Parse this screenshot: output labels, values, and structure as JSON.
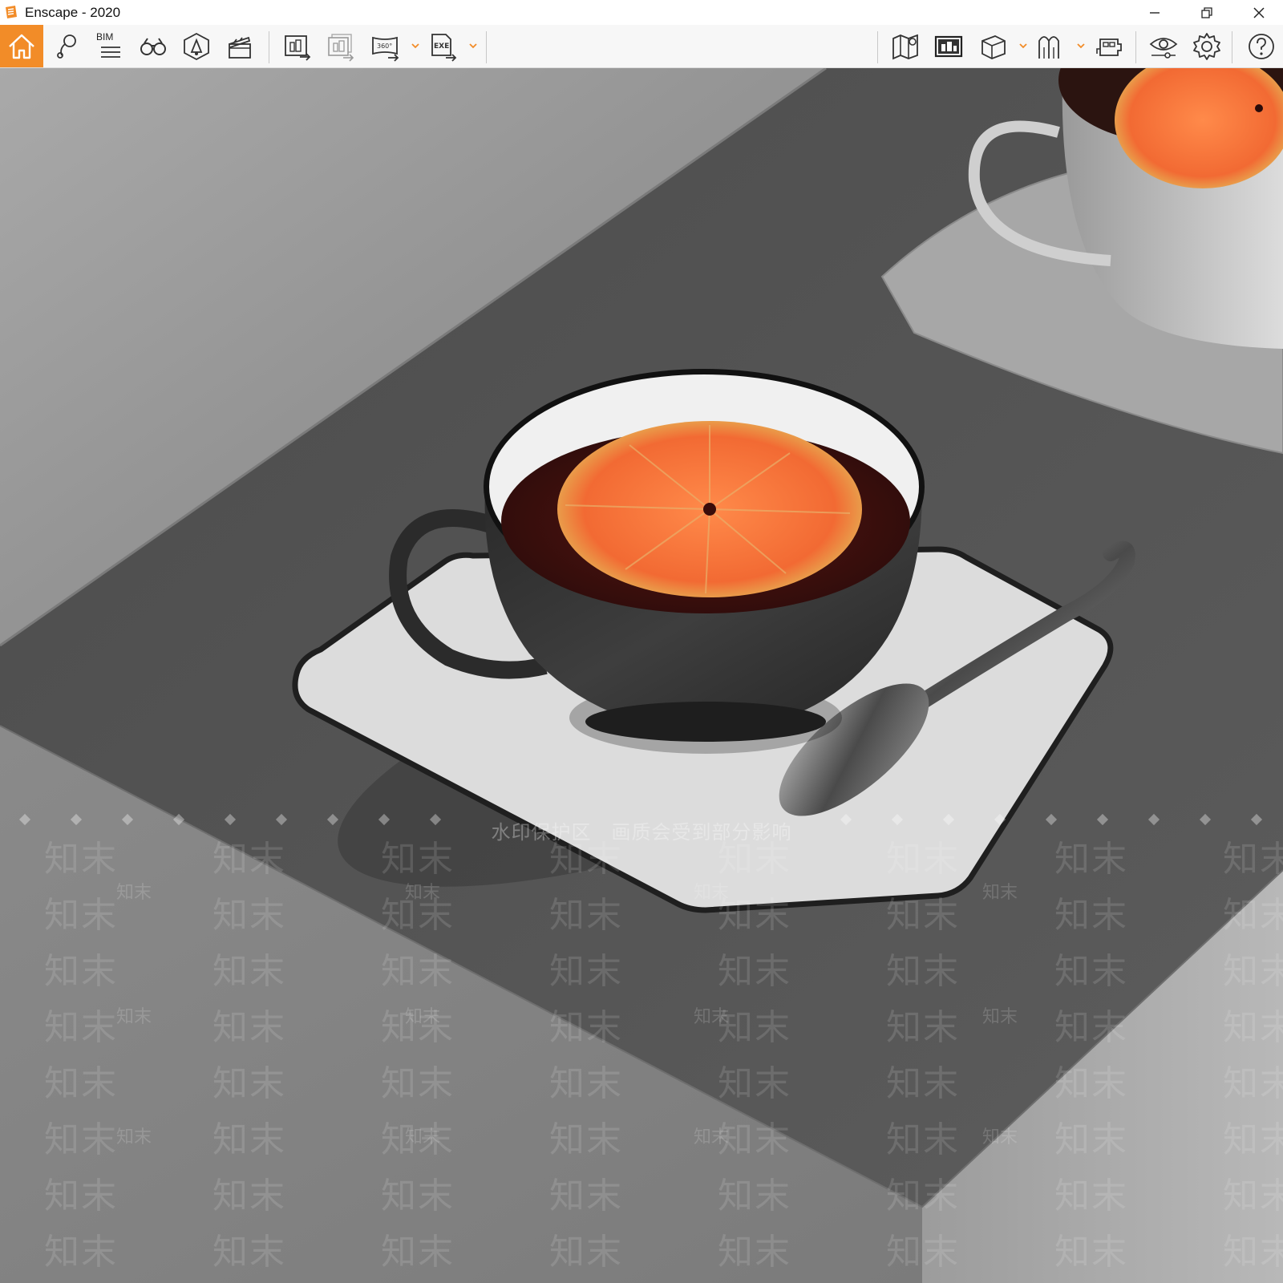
{
  "window": {
    "title": "Enscape - 2020",
    "minimize": "—",
    "restore": "❐",
    "close": "✕"
  },
  "toolbar": {
    "accent": "#f28c28",
    "bim_label": "BIM",
    "left_tools": [
      "home-icon",
      "location-pin-icon",
      "bim-info-icon",
      "binoculars-icon",
      "asset-library-icon",
      "video-editor-icon",
      "export-screenshot-icon",
      "batch-render-icon",
      "export-panorama-icon",
      "export-exe-icon"
    ],
    "right_tools": [
      "map-icon",
      "view-management-icon",
      "material-editor-icon",
      "site-context-icon",
      "vr-headset-icon",
      "visual-settings-icon",
      "settings-icon",
      "help-icon"
    ]
  },
  "viewport": {
    "watermark_notice": "水印保护区　画质会受到部分影响",
    "watermark_text": "知末",
    "watermark_small": "知末"
  }
}
